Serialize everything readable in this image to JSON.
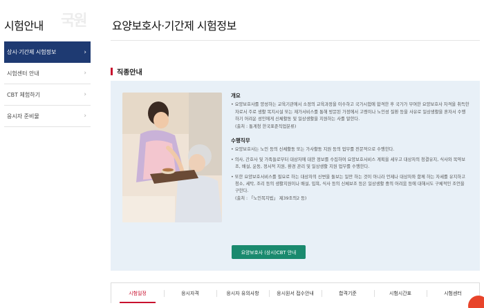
{
  "sidebar": {
    "title": "시험안내",
    "watermark": "국원",
    "items": [
      {
        "label": "상시·기간제 시험정보",
        "active": true
      },
      {
        "label": "시험센터 안내",
        "active": false
      },
      {
        "label": "CBT 체험하기",
        "active": false
      },
      {
        "label": "응시자 준비물",
        "active": false
      }
    ]
  },
  "page": {
    "title": "요양보호사·기간제 시험정보",
    "section_title": "직종안내"
  },
  "job_info": {
    "overview_title": "개요",
    "overview_text": "요양보호사를 양성하는 교육기관에서 소정의 교육과정을 이수하고 국가시험에 합격한 후 국가가 부여한 요양보호사 자격을 취득한자로서 주로 생활 복지시설 또는 재가서비스를 통해 방문된 가정에서 고령이나 노인성 질환 등을 사유로 일상생활을 혼자서 수행하기 어려운 성인에게 신체활동 및 일상생활을 지원하는 사를 말한다.",
    "overview_source": "(출처 : 통계청 한국표준직업분류)",
    "duties_title": "수행직무",
    "duties": [
      "요양보호사는 노인 등의 신체활동 또는 가사활동 지원 등의 업무를 전문적으로 수행한다.",
      "의사, 간호사 및 가족들로부터 대상자에 대한 정보를 수집하여 요양보호서비스 계획을 세우고 대상자의 청결유지, 식사와 복약보조, 배설, 운동, 정서적 지원, 환경 관리 및 일상생활 지원 업무를 수행한다.",
      "또한 요양보호서비스를 필요로 하는 대상자의 신변을 돌보는 일만 하는 것이 아니라 언제나 대상자와 함께 하는 자세를 유지하고 청소, 세탁, 조리 등의 생활지원이나 배설, 입욕, 식사 등의 신체보조 등은 일상생활 중의 어려움 등에 대해서도 구체적인 조언을 구한다."
    ],
    "duties_source": "(출처 : 「노인복지법」 제39조의2 등)",
    "cbt_button": "요양보호사 (상시)CBT 안내"
  },
  "tabs": [
    "시험일정",
    "응시자격",
    "응시자 유의사항",
    "응시원서 접수안내",
    "합격기준",
    "시험시간표",
    "시험센터"
  ],
  "active_tab": 0,
  "colors": {
    "navy": "#1e3a72",
    "accent_red": "#c8102e",
    "button_green": "#1a8a6e",
    "box_bg": "#e8f0f7"
  }
}
